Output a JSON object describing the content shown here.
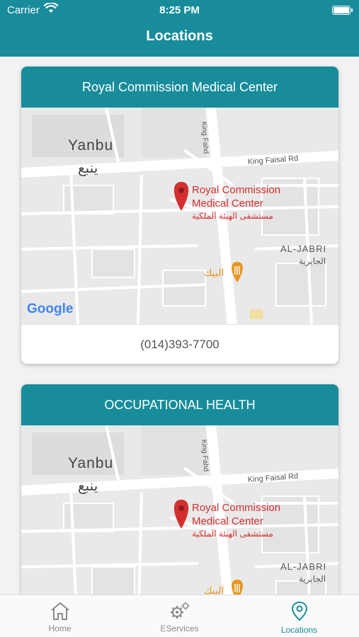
{
  "status_bar": {
    "carrier": "Carrier",
    "time": "8:25 PM"
  },
  "nav": {
    "title": "Locations"
  },
  "colors": {
    "accent": "#188c9b",
    "marker": "#d32f2f",
    "poi": "#e5961f"
  },
  "locations": [
    {
      "title": "Royal Commission Medical Center",
      "phone": "(014)393-7700",
      "map": {
        "city_en": "Yanbu",
        "city_ar": "ينبع",
        "road_king_fahd": "King Fahd",
        "road_king_faisal": "King Faisal Rd",
        "marker_label_line1": "Royal Commission",
        "marker_label_line2": "Medical Center",
        "marker_label_ar": "مستشفى الهيئة الملكية",
        "district_en": "AL-JABRI",
        "district_ar": "الجابرية",
        "poi_label": "البيك",
        "logo": "Google"
      }
    },
    {
      "title": "OCCUPATIONAL HEALTH",
      "map": {
        "city_en": "Yanbu",
        "city_ar": "ينبع",
        "road_king_fahd": "King Fahd",
        "road_king_faisal": "King Faisal Rd",
        "marker_label_line1": "Royal Commission",
        "marker_label_line2": "Medical Center",
        "marker_label_ar": "مستشفى الهيئة الملكية",
        "district_en": "AL-JABRI",
        "district_ar": "الجابرية",
        "poi_label": "البيك"
      }
    }
  ],
  "tabs": [
    {
      "label": "Home",
      "icon": "home-icon",
      "active": false
    },
    {
      "label": "EServices",
      "icon": "gear-icon",
      "active": false
    },
    {
      "label": "Locations",
      "icon": "location-pin-icon",
      "active": true
    }
  ]
}
